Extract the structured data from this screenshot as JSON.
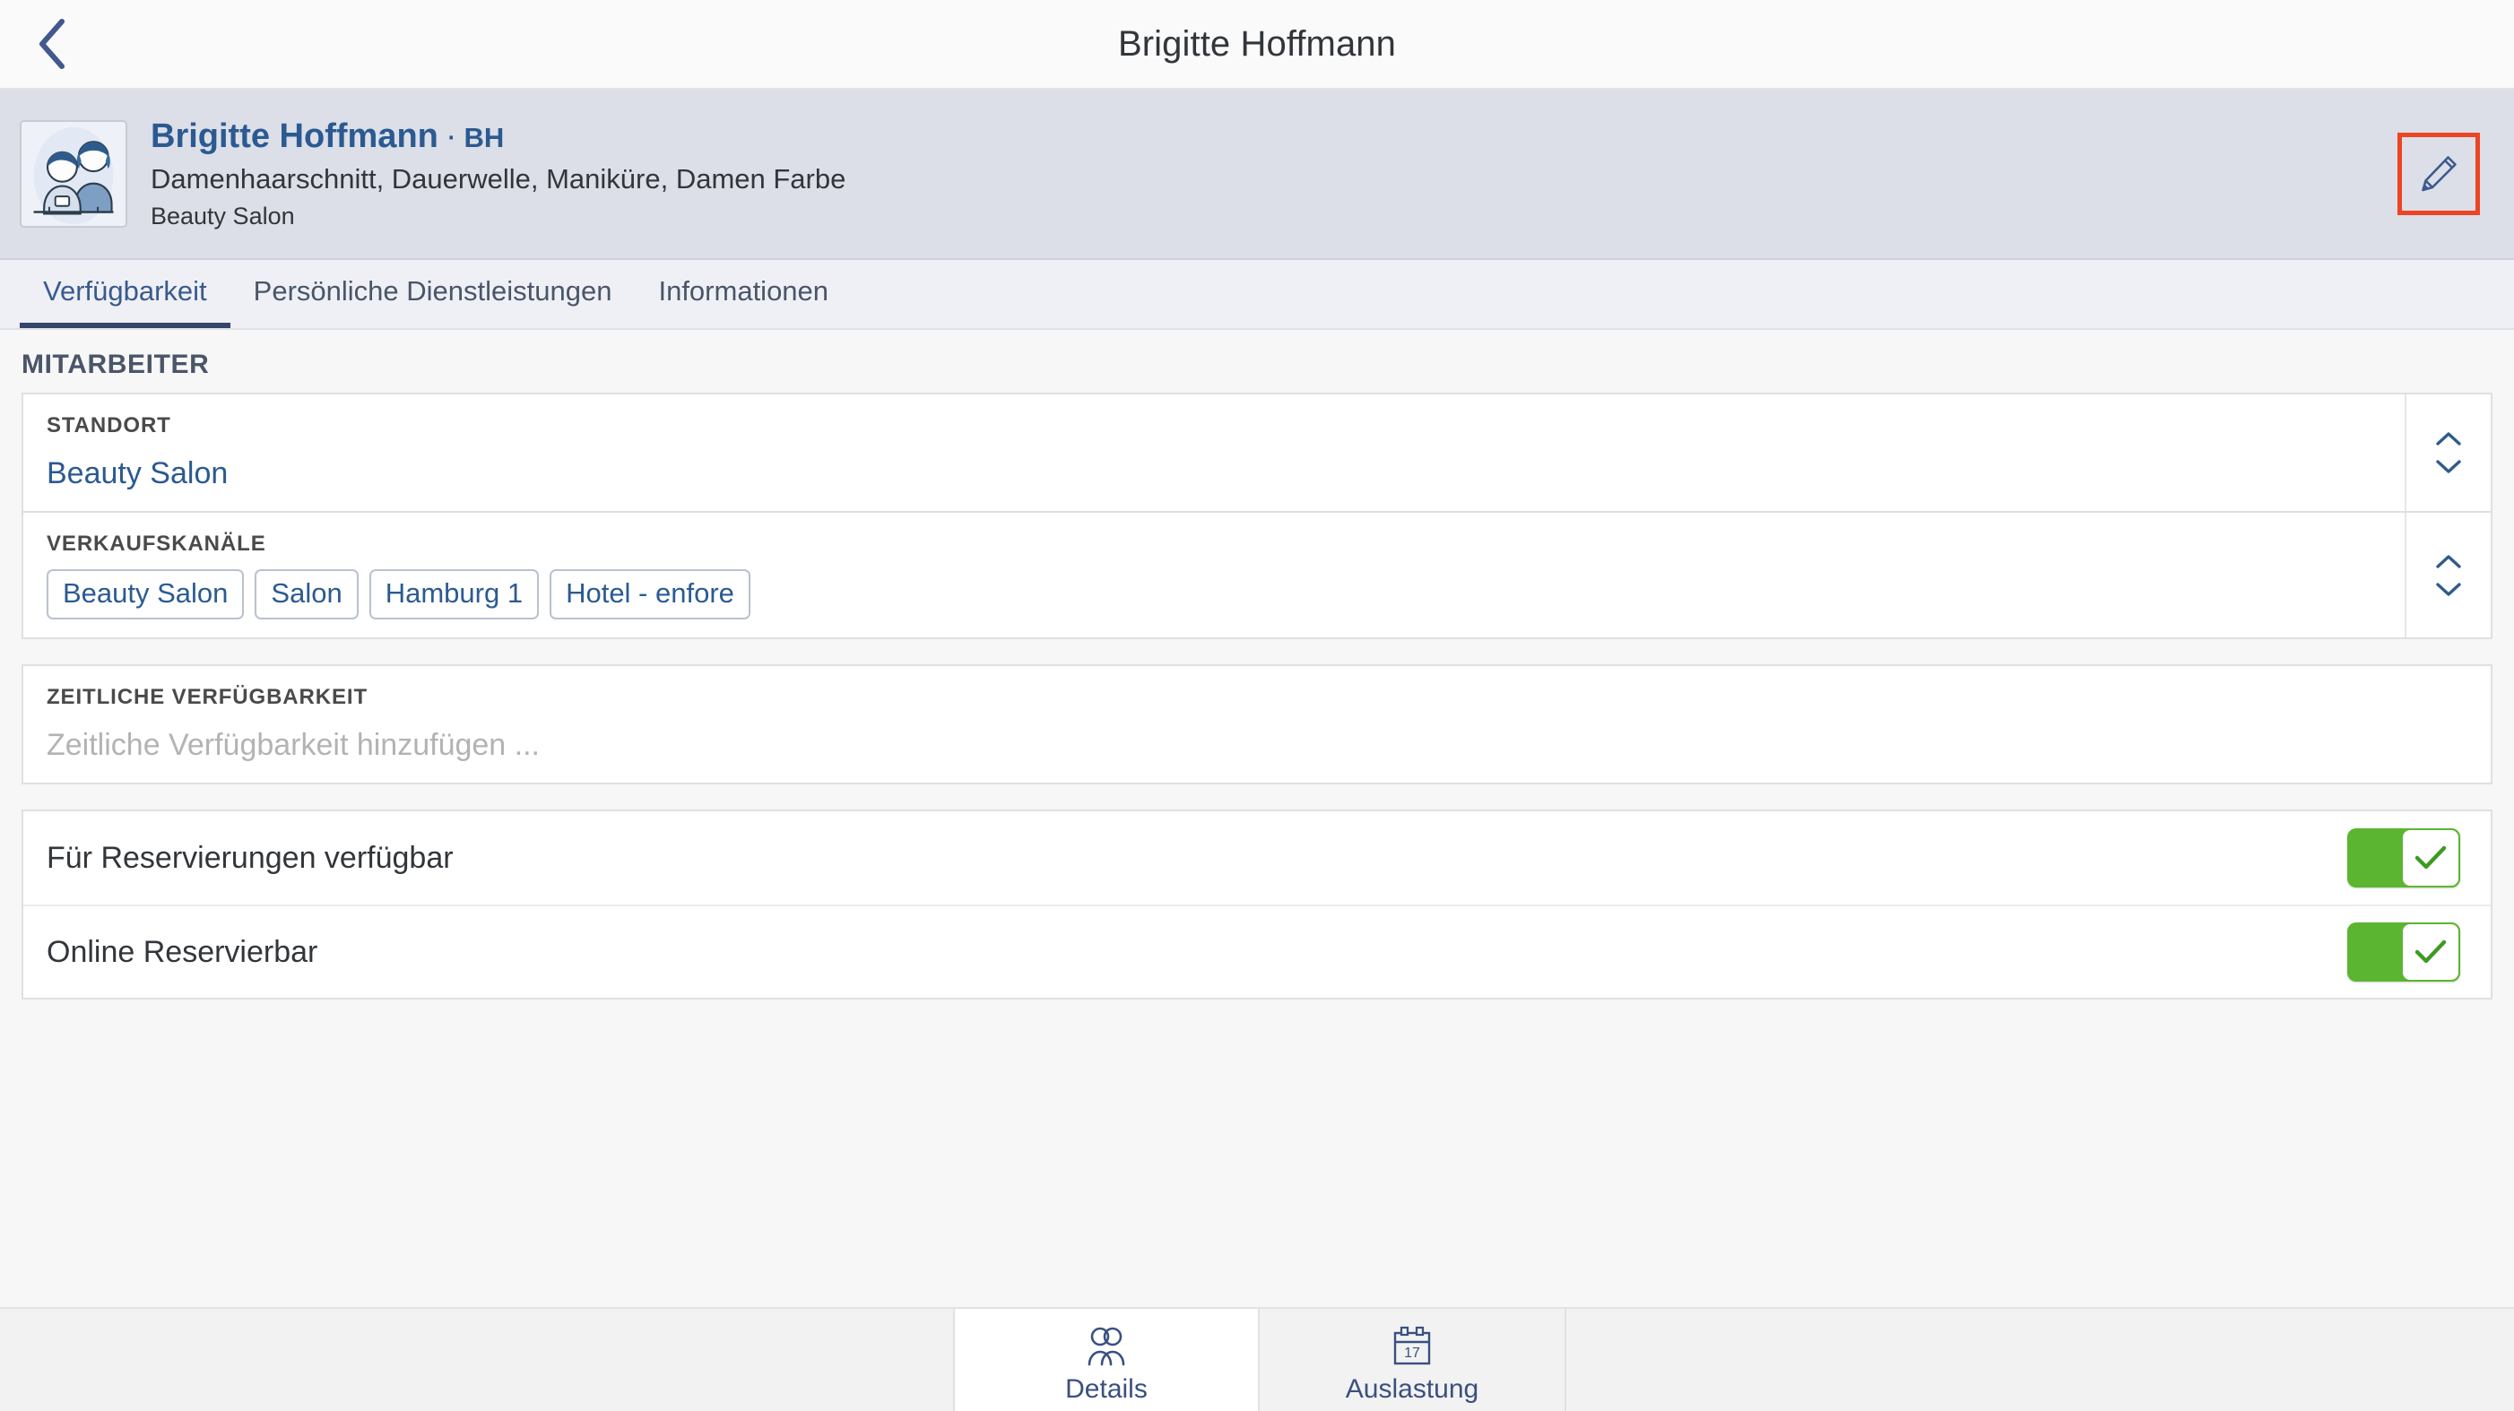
{
  "topbar": {
    "back_icon": "chevron-left-icon",
    "title": "Brigitte Hoffmann"
  },
  "profile": {
    "avatar_icon": "people-avatar-icon",
    "name": "Brigitte Hoffmann",
    "name_separator": "·",
    "initials": "BH",
    "services": "Damenhaarschnitt, Dauerwelle, Maniküre, Damen Farbe",
    "organization": "Beauty Salon",
    "edit_icon": "pencil-icon",
    "edit_highlight_color": "#ec4424"
  },
  "tabs": {
    "items": [
      {
        "label": "Verfügbarkeit",
        "active": true
      },
      {
        "label": "Persönliche Dienstleistungen",
        "active": false
      },
      {
        "label": "Informationen",
        "active": false
      }
    ]
  },
  "main": {
    "section_title": "MITARBEITER",
    "standort": {
      "label": "STANDORT",
      "value": "Beauty Salon",
      "stepper_icons": "chevron-up-down-icon"
    },
    "verkaufskanaele": {
      "label": "VERKAUFSKANÄLE",
      "chips": [
        "Beauty Salon",
        "Salon",
        "Hamburg 1",
        "Hotel - enfore"
      ],
      "stepper_icons": "chevron-up-down-icon"
    },
    "zeitliche_verfuegbarkeit": {
      "label": "ZEITLICHE VERFÜGBARKEIT",
      "placeholder": "Zeitliche Verfügbarkeit hinzufügen ..."
    },
    "toggles": [
      {
        "label": "Für Reservierungen verfügbar",
        "on": true
      },
      {
        "label": "Online Reservierbar",
        "on": true
      }
    ],
    "toggle_on_color": "#5cb531"
  },
  "bottombar": {
    "items": [
      {
        "label": "Details",
        "icon": "people-icon",
        "active": true
      },
      {
        "label": "Auslastung",
        "icon": "calendar-17-icon",
        "active": false
      }
    ],
    "calendar_day": "17"
  }
}
